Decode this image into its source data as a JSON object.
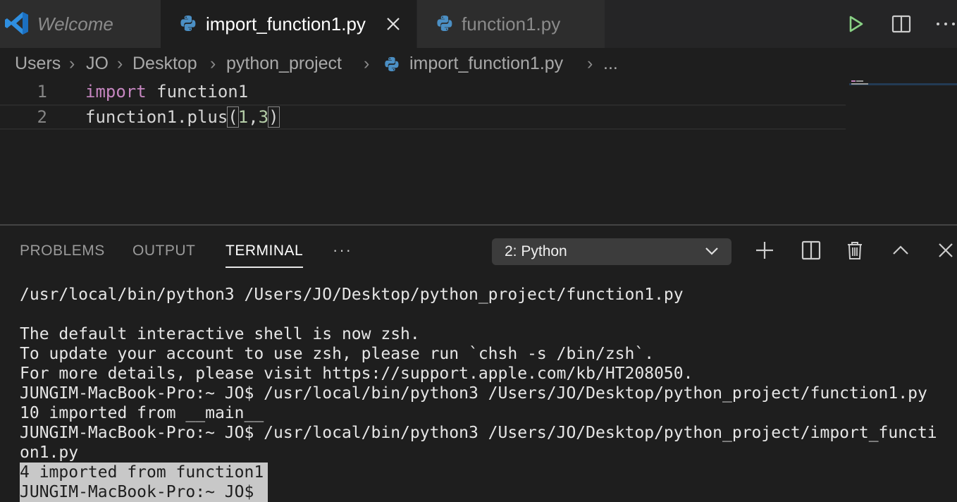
{
  "tabs": [
    {
      "label": "Welcome"
    },
    {
      "label": "import_function1.py"
    },
    {
      "label": "function1.py"
    }
  ],
  "breadcrumb": {
    "items": [
      "Users",
      "JO",
      "Desktop",
      "python_project",
      "import_function1.py",
      "..."
    ]
  },
  "editor": {
    "lines": [
      {
        "number": "1",
        "keyword": "import",
        "rest": " function1"
      },
      {
        "number": "2",
        "pre": "function1.plus",
        "open": "(",
        "a": "1",
        "comma": ",",
        "b": "3",
        "close": ")"
      }
    ]
  },
  "panel": {
    "tabs": [
      "PROBLEMS",
      "OUTPUT",
      "TERMINAL"
    ],
    "active_tab": "TERMINAL",
    "more": "···",
    "terminal_select": "2: Python"
  },
  "terminal": {
    "lines": [
      "/usr/local/bin/python3 /Users/JO/Desktop/python_project/function1.py",
      "",
      "The default interactive shell is now zsh.",
      "To update your account to use zsh, please run `chsh -s /bin/zsh`.",
      "For more details, please visit https://support.apple.com/kb/HT208050.",
      "JUNGIM-MacBook-Pro:~ JO$ /usr/local/bin/python3 /Users/JO/Desktop/python_project/function1.py",
      "10 imported from __main__",
      "JUNGIM-MacBook-Pro:~ JO$ /usr/local/bin/python3 /Users/JO/Desktop/python_project/import_functi",
      "on1.py",
      "4 imported from function1",
      "JUNGIM-MacBook-Pro:~ JO$ "
    ]
  },
  "colors": {
    "accent_blue": "#3c8bd9",
    "run_green": "#89d185",
    "keyword": "#c586c0",
    "number": "#b5cea8"
  }
}
